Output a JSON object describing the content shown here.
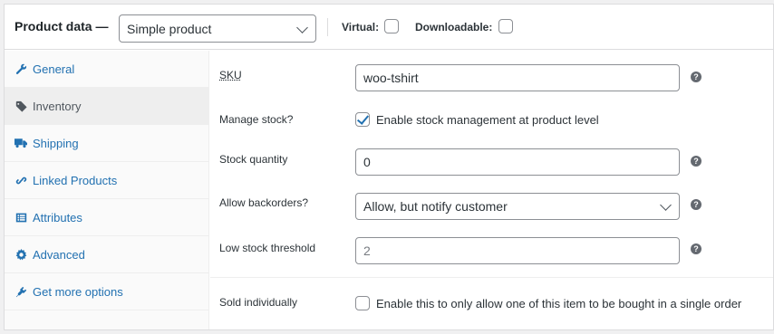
{
  "header": {
    "title": "Product data —",
    "product_type": "Simple product",
    "virtual_label": "Virtual:",
    "virtual_checked": false,
    "downloadable_label": "Downloadable:",
    "downloadable_checked": false
  },
  "sidebar": {
    "items": [
      {
        "label": "General",
        "icon": "wrench-icon",
        "active": false
      },
      {
        "label": "Inventory",
        "icon": "tag-icon",
        "active": true
      },
      {
        "label": "Shipping",
        "icon": "truck-icon",
        "active": false
      },
      {
        "label": "Linked Products",
        "icon": "link-icon",
        "active": false
      },
      {
        "label": "Attributes",
        "icon": "list-icon",
        "active": false
      },
      {
        "label": "Advanced",
        "icon": "gear-icon",
        "active": false
      },
      {
        "label": "Get more options",
        "icon": "plugin-icon",
        "active": false
      }
    ]
  },
  "inventory": {
    "sku_label": "SKU",
    "sku_value": "woo-tshirt",
    "manage_stock_label": "Manage stock?",
    "manage_stock_text": "Enable stock management at product level",
    "manage_stock_checked": true,
    "stock_qty_label": "Stock quantity",
    "stock_qty_value": "0",
    "backorders_label": "Allow backorders?",
    "backorders_value": "Allow, but notify customer",
    "low_stock_label": "Low stock threshold",
    "low_stock_placeholder": "2",
    "sold_individually_label": "Sold individually",
    "sold_individually_text": "Enable this to only allow one of this item to be bought in a single order",
    "sold_individually_checked": false,
    "help_glyph": "?"
  },
  "colors": {
    "link": "#2271b1",
    "active_tab_bg": "#eeeeee",
    "border": "#8c8f94"
  }
}
